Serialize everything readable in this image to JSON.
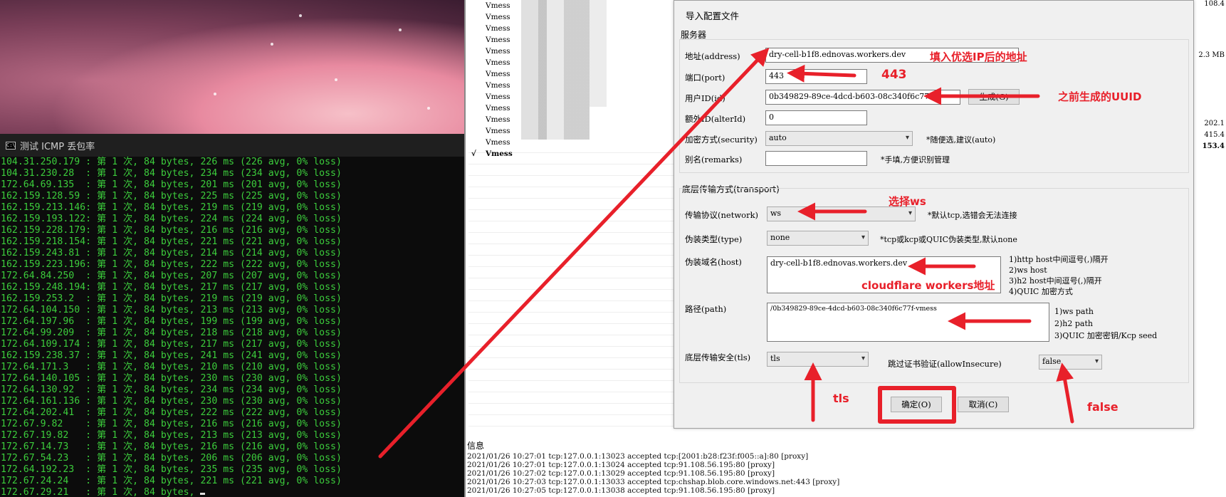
{
  "console": {
    "title": "测试 ICMP 丢包率",
    "lines": [
      "104.31.250.179 : 第 1 次, 84 bytes, 226 ms (226 avg, 0% loss)",
      "104.31.230.28  : 第 1 次, 84 bytes, 234 ms (234 avg, 0% loss)",
      "172.64.69.135  : 第 1 次, 84 bytes, 201 ms (201 avg, 0% loss)",
      "162.159.128.59 : 第 1 次, 84 bytes, 225 ms (225 avg, 0% loss)",
      "162.159.213.146: 第 1 次, 84 bytes, 219 ms (219 avg, 0% loss)",
      "162.159.193.122: 第 1 次, 84 bytes, 224 ms (224 avg, 0% loss)",
      "162.159.228.179: 第 1 次, 84 bytes, 216 ms (216 avg, 0% loss)",
      "162.159.218.154: 第 1 次, 84 bytes, 221 ms (221 avg, 0% loss)",
      "162.159.243.81 : 第 1 次, 84 bytes, 214 ms (214 avg, 0% loss)",
      "162.159.223.196: 第 1 次, 84 bytes, 222 ms (222 avg, 0% loss)",
      "172.64.84.250  : 第 1 次, 84 bytes, 207 ms (207 avg, 0% loss)",
      "162.159.248.194: 第 1 次, 84 bytes, 217 ms (217 avg, 0% loss)",
      "162.159.253.2  : 第 1 次, 84 bytes, 219 ms (219 avg, 0% loss)",
      "172.64.104.150 : 第 1 次, 84 bytes, 213 ms (213 avg, 0% loss)",
      "172.64.197.96  : 第 1 次, 84 bytes, 199 ms (199 avg, 0% loss)",
      "172.64.99.209  : 第 1 次, 84 bytes, 218 ms (218 avg, 0% loss)",
      "172.64.109.174 : 第 1 次, 84 bytes, 217 ms (217 avg, 0% loss)",
      "162.159.238.37 : 第 1 次, 84 bytes, 241 ms (241 avg, 0% loss)",
      "172.64.171.3   : 第 1 次, 84 bytes, 210 ms (210 avg, 0% loss)",
      "172.64.140.105 : 第 1 次, 84 bytes, 230 ms (230 avg, 0% loss)",
      "172.64.130.92  : 第 1 次, 84 bytes, 234 ms (234 avg, 0% loss)",
      "172.64.161.136 : 第 1 次, 84 bytes, 230 ms (230 avg, 0% loss)",
      "172.64.202.41  : 第 1 次, 84 bytes, 222 ms (222 avg, 0% loss)",
      "172.67.9.82    : 第 1 次, 84 bytes, 216 ms (216 avg, 0% loss)",
      "172.67.19.82   : 第 1 次, 84 bytes, 213 ms (213 avg, 0% loss)",
      "172.67.14.73   : 第 1 次, 84 bytes, 216 ms (216 avg, 0% loss)",
      "172.67.54.23   : 第 1 次, 84 bytes, 206 ms (206 avg, 0% loss)",
      "172.64.192.23  : 第 1 次, 84 bytes, 235 ms (235 avg, 0% loss)",
      "172.67.24.24   : 第 1 次, 84 bytes, 221 ms (221 avg, 0% loss)",
      "172.67.29.21   : 第 1 次, 84 bytes,"
    ]
  },
  "server_list": {
    "rows": [
      "Vmess",
      "Vmess",
      "Vmess",
      "Vmess",
      "Vmess",
      "Vmess",
      "Vmess",
      "Vmess",
      "Vmess",
      "Vmess",
      "Vmess",
      "Vmess",
      "Vmess"
    ],
    "active_row": "Vmess",
    "active_mark": "√",
    "right_values": [
      "108.4",
      "2.3 MB",
      "202.1",
      "415.4",
      "153.4"
    ]
  },
  "dialog": {
    "title": "导入配置文件",
    "server_group": "服务器",
    "address_label": "地址(address)",
    "address_value": "dry-cell-b1f8.ednovas.workers.dev",
    "port_label": "端口(port)",
    "port_value": "443",
    "userid_label": "用户ID(id)",
    "userid_value": "0b349829-89ce-4dcd-b603-08c340f6c77f",
    "generate_button": "生成(G)",
    "alterid_label": "额外ID(alterId)",
    "alterid_value": "0",
    "security_label": "加密方式(security)",
    "security_value": "auto",
    "security_hint": "*随便选,建议(auto)",
    "remarks_label": "别名(remarks)",
    "remarks_value": "",
    "remarks_hint": "*手填,方便识别管理",
    "transport_group": "底层传输方式(transport)",
    "network_label": "传输协议(network)",
    "network_value": "ws",
    "network_hint": "*默认tcp,选错会无法连接",
    "type_label": "伪装类型(type)",
    "type_value": "none",
    "type_hint": "*tcp或kcp或QUIC伪装类型,默认none",
    "host_label": "伪装域名(host)",
    "host_value": "dry-cell-b1f8.ednovas.workers.dev",
    "host_hints": [
      "1)http host中间逗号(,)隔开",
      "2)ws host",
      "3)h2 host中间逗号(,)隔开",
      "4)QUIC 加密方式"
    ],
    "path_label": "路径(path)",
    "path_value": "/0b349829-89ce-4dcd-b603-08c340f6c77f-vmess",
    "path_hints": [
      "1)ws path",
      "2)h2 path",
      "3)QUIC 加密密钥/Kcp seed"
    ],
    "tls_label": "底层传输安全(tls)",
    "tls_value": "tls",
    "insecure_label": "跳过证书验证(allowInsecure)",
    "insecure_value": "false",
    "ok_button": "确定(O)",
    "cancel_button": "取消(C)"
  },
  "info": {
    "label": "信息",
    "logs": [
      "2021/01/26 10:27:01 tcp:127.0.0.1:13023 accepted tcp:[2001:b28:f23f:f005::a]:80 [proxy]",
      "2021/01/26 10:27:01 tcp:127.0.0.1:13024 accepted tcp:91.108.56.195:80 [proxy]",
      "2021/01/26 10:27:02 tcp:127.0.0.1:13029 accepted tcp:91.108.56.195:80 [proxy]",
      "2021/01/26 10:27:03 tcp:127.0.0.1:13033 accepted tcp:chshap.blob.core.windows.net:443 [proxy]",
      "2021/01/26 10:27:05 tcp:127.0.0.1:13038 accepted tcp:91.108.56.195:80 [proxy]"
    ]
  },
  "annotations": {
    "address": "填入优选IP后的地址",
    "port": "443",
    "uuid": "之前生成的UUID",
    "network": "选择ws",
    "host": "cloudflare workers地址",
    "tls": "tls",
    "insecure": "false"
  },
  "colors": {
    "annotation_red": "#e8202a",
    "console_green": "#3ccd3c"
  }
}
